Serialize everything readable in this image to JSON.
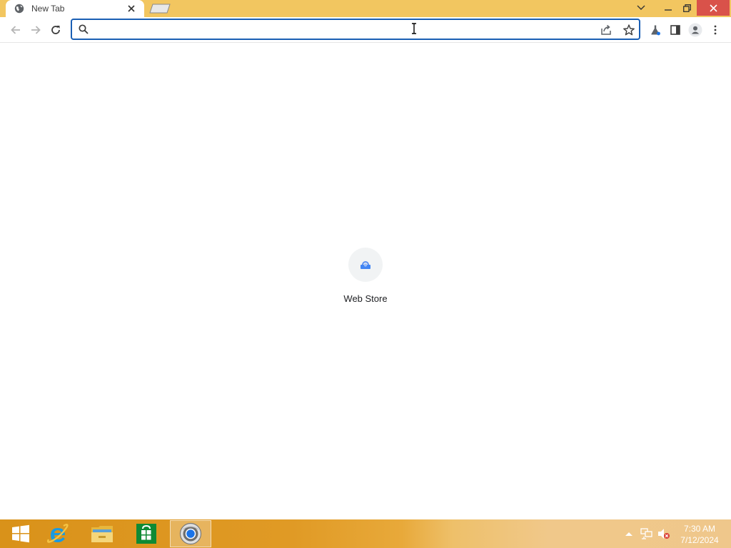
{
  "browser": {
    "tab": {
      "title": "New Tab",
      "favicon": "globe-icon",
      "close_icon": "close-icon"
    },
    "new_tab_icon": "new-tab-icon",
    "window_controls": [
      "tab-search-icon",
      "minimize-icon",
      "restore-icon",
      "close-icon"
    ],
    "toolbar": {
      "back_icon": "arrow-left-icon",
      "forward_icon": "arrow-right-icon",
      "reload_icon": "reload-icon",
      "omnibox": {
        "value": "",
        "placeholder": "",
        "search_icon": "search-icon",
        "share_icon": "share-icon",
        "bookmark_icon": "star-icon"
      },
      "extensions_icon": "lab-flask-icon",
      "side_panel_icon": "side-panel-icon",
      "profile_icon": "profile-icon",
      "menu_icon": "kebab-menu-icon"
    }
  },
  "new_tab_page": {
    "shortcuts": [
      {
        "label": "Web Store",
        "icon": "web-store-icon"
      }
    ]
  },
  "taskbar": {
    "start_icon": "windows-start-icon",
    "pinned": [
      {
        "name": "Internet Explorer",
        "icon": "internet-explorer-icon"
      },
      {
        "name": "File Explorer",
        "icon": "file-explorer-icon"
      },
      {
        "name": "Store",
        "icon": "store-icon"
      },
      {
        "name": "Chromium",
        "icon": "chromium-icon",
        "active": true
      }
    ],
    "tray": {
      "icons": [
        "show-hidden-icons-icon",
        "network-icon",
        "volume-muted-icon"
      ],
      "time": "7:30 AM",
      "date": "7/12/2024"
    }
  },
  "colors": {
    "titlebar": "#f2c660",
    "omnibox_border": "#1a5fb4",
    "close_button": "#d9524a",
    "taskbar": "#e09a25"
  }
}
